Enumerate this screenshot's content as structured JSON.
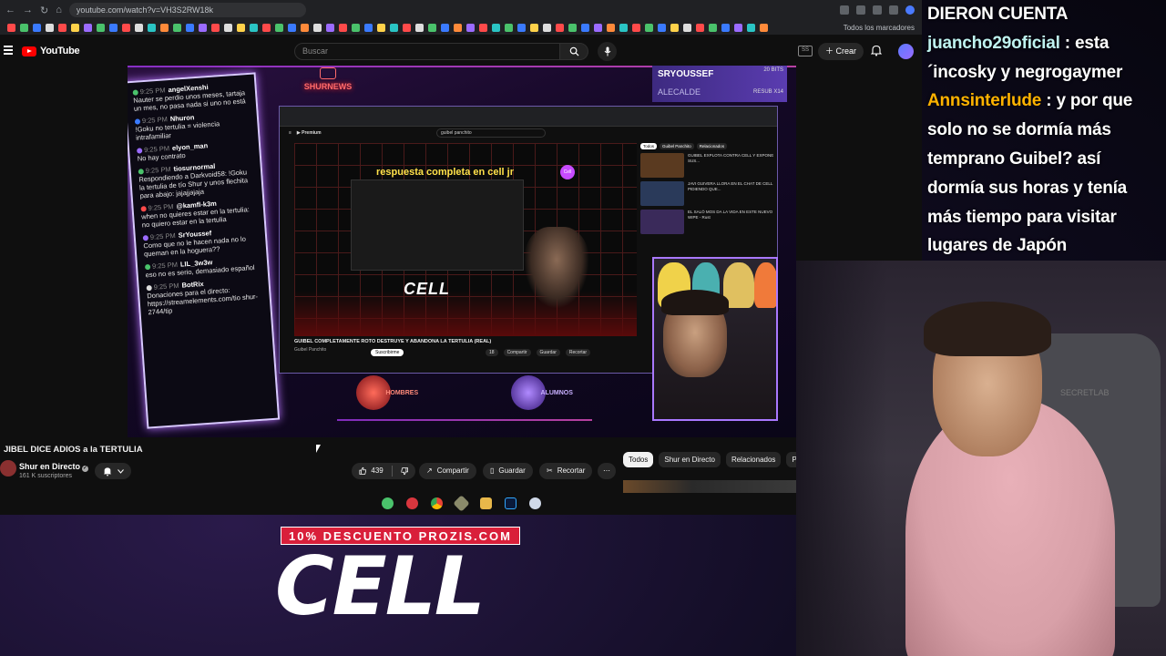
{
  "browser": {
    "url": "youtube.com/watch?v=VH3S2RW18k",
    "bookmarks_all_label": "Todos los marcadores"
  },
  "youtube": {
    "logo_text": "YouTube",
    "search_placeholder": "Buscar",
    "create_label": "Crear",
    "cast_label": "SS"
  },
  "player": {
    "shurnews_label": "SHURNEWS",
    "sub_alert": {
      "name": "SRYOUSSEF",
      "bits": "20 BITS",
      "sub_name": "ALECALDE",
      "result": "RESUB X14"
    },
    "chat": [
      {
        "ts": "9:25 PM",
        "user": "angelXenshi",
        "msg": "Nauter se perdio unos meses, tartaja un mes, no pasa nada si uno no está"
      },
      {
        "ts": "9:25 PM",
        "user": "Nhuron",
        "msg": "!Goku no tertulia = violencia intrafamiliar"
      },
      {
        "ts": "9:25 PM",
        "user": "elyon_man",
        "msg": "No hay contrato"
      },
      {
        "ts": "9:25 PM",
        "user": "tiosurnormal",
        "msg": "Respondiendo a Darkvoid58: !Goku la tertulia de tío Shur y unos flechita para abajo: jajajjajaja"
      },
      {
        "ts": "9:25 PM",
        "user": "@kamfl-k3m",
        "msg": "when no quieres estar en la tertulia: no quiero estar en la tertulia"
      },
      {
        "ts": "9:25 PM",
        "user": "SrYoussef",
        "msg": "Como que no le hacen nada no lo queman en la hoguera??"
      },
      {
        "ts": "9:25 PM",
        "user": "LIL_3w3w",
        "msg": "eso no es serio, demasiado español"
      },
      {
        "ts": "9:25 PM",
        "user": "BotRix",
        "msg": "Donaciones para el directo: https://streamelements.com/tio shur-2744/tip"
      }
    ],
    "inner": {
      "search_text": "guibel panchito",
      "caption": "respuesta completa en cell jr",
      "badge": "Cell",
      "cell_text": "CELL",
      "title": "GUIBEL COMPLETAMENTE ROTO DESTRUYE Y ABANDONA LA TERTULIA (REAL)",
      "channel": "Guibel Panchito",
      "subscribe": "Suscribirme",
      "actions": [
        "18",
        "Compartir",
        "Guardar",
        "Recortar"
      ],
      "side_chips": [
        "Todos",
        "Guibel Panchito",
        "Relacionados"
      ],
      "side_videos": [
        "GUIBEL EXPLOTA CONTRA CELL Y EXPONE SUS...",
        "JAVI GUIVERA LLORA EN EL CHAT DE CELL PIDIENDO QUE...",
        "EL SALÓ MOS DA LA VIDA EN ESTE NUEVO WIPE - Rust"
      ]
    },
    "role_left": "HOMBRES",
    "role_right": "ALUMNOS"
  },
  "video": {
    "title": "JIBEL DICE ADIOS a la TERTULIA",
    "channel": "Shur en Directo",
    "subscribers": "161 K suscriptores",
    "likes": "439",
    "share_label": "Compartir",
    "save_label": "Guardar",
    "clip_label": "Recortar",
    "chips": [
      "Todos",
      "Shur en Directo",
      "Relacionados",
      "Par"
    ]
  },
  "promo": {
    "banner": "10% DESCUENTO PROZIS.COM",
    "big": "CELL"
  },
  "stream_chat": [
    {
      "user": "",
      "msg": "DIERON CUENTA"
    },
    {
      "user": "juancho29oficial",
      "msg": ": esta"
    },
    {
      "user": "",
      "msg": "´incosky y negrogaymer"
    },
    {
      "user": "Annsinterlude",
      "msg": ": y por que"
    },
    {
      "user": "",
      "msg": "solo no se dormía más"
    },
    {
      "user": "",
      "msg": "temprano Guibel? así"
    },
    {
      "user": "",
      "msg": "dormía sus horas y tenía"
    },
    {
      "user": "",
      "msg": "más tiempo para visitar"
    },
    {
      "user": "",
      "msg": "lugares de Japón"
    }
  ],
  "webcam": {
    "chair_brand": "SECRETLAB"
  }
}
